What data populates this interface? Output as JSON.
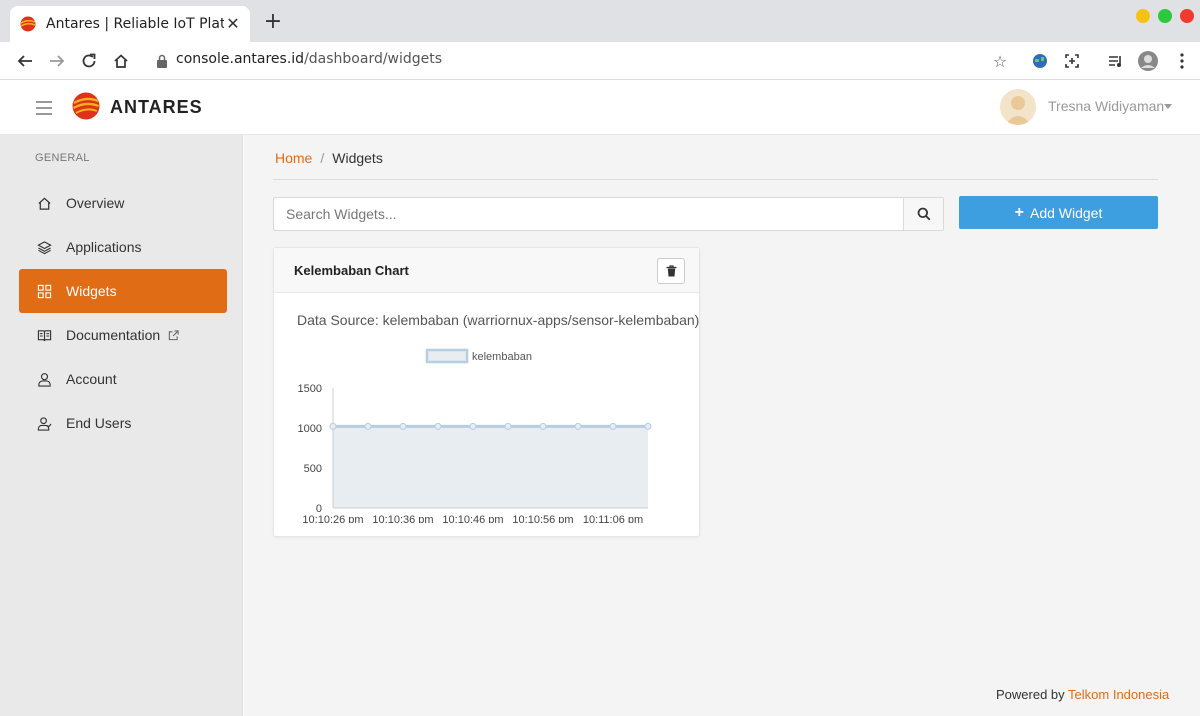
{
  "browser": {
    "tab_title": "Antares | Reliable IoT Platf",
    "close_glyph": "✕",
    "new_tab_glyph": "+",
    "url_host": "console.antares.id",
    "url_path": "/dashboard/widgets",
    "window_colors": {
      "minimize": "#f5c211",
      "maximize": "#2bc840",
      "close": "#f03a2e"
    }
  },
  "header": {
    "brand": "ANTARES",
    "user_name": "Tresna Widiyaman",
    "accent": "#e06c16"
  },
  "sidebar": {
    "heading": "GENERAL",
    "items": [
      {
        "label": "Overview",
        "icon": "home-icon",
        "active": false
      },
      {
        "label": "Applications",
        "icon": "layers-icon",
        "active": false
      },
      {
        "label": "Widgets",
        "icon": "grid-icon",
        "active": true
      },
      {
        "label": "Documentation",
        "icon": "book-icon",
        "active": false,
        "external": true
      },
      {
        "label": "Account",
        "icon": "user-icon",
        "active": false
      },
      {
        "label": "End Users",
        "icon": "users-icon",
        "active": false
      }
    ]
  },
  "breadcrumb": {
    "home": "Home",
    "separator": "/",
    "current": "Widgets"
  },
  "search": {
    "placeholder": "Search Widgets...",
    "value": ""
  },
  "add_widget": {
    "label": "Add Widget",
    "color": "#3d9ee0"
  },
  "widget": {
    "title": "Kelembaban Chart",
    "data_source": "Data Source: kelembaban (warriornux-apps/sensor-kelembaban)"
  },
  "chart_data": {
    "type": "area",
    "title": "",
    "xlabel": "",
    "ylabel": "",
    "legend_position": "top",
    "x": [
      "10:10:26 pm",
      "10:10:31 pm",
      "10:10:36 pm",
      "10:10:41 pm",
      "10:10:46 pm",
      "10:10:51 pm",
      "10:10:56 pm",
      "10:11:01 pm",
      "10:11:06 pm",
      "10:11:11 pm"
    ],
    "x_tick_labels": [
      "10:10:26 pm",
      "10:10:36 pm",
      "10:10:46 pm",
      "10:10:56 pm",
      "10:11:06 pm"
    ],
    "series": [
      {
        "name": "kelembaban",
        "values": [
          1020,
          1020,
          1020,
          1020,
          1020,
          1020,
          1020,
          1020,
          1020,
          1020
        ],
        "line_color": "#b7cde0",
        "fill_color": "#e8edf2"
      }
    ],
    "ylim": [
      0,
      1500
    ],
    "y_ticks": [
      0,
      500,
      1000,
      1500
    ],
    "grid": false
  },
  "footer": {
    "text": "Powered by",
    "link": "Telkom Indonesia"
  }
}
